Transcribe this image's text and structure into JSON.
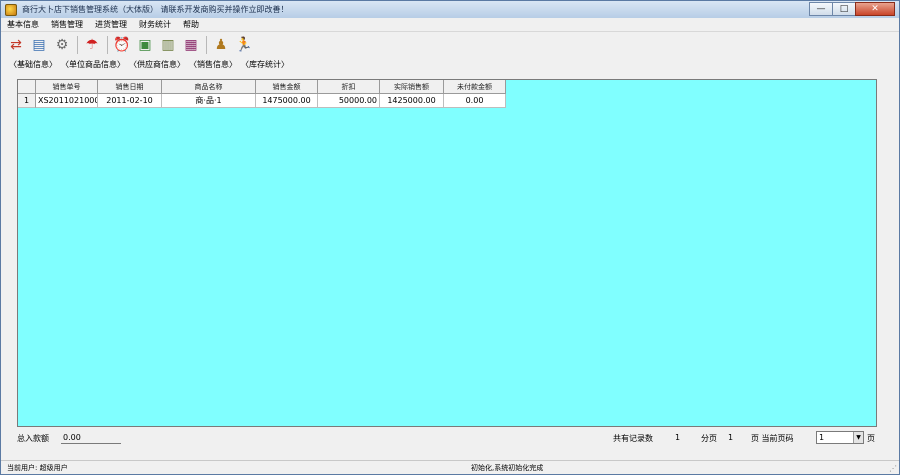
{
  "window": {
    "title": "商行大卜店下销售管理系统（大体版）  请联系开发商购买并操作立即改善！",
    "minimize_label": "—",
    "maximize_label": "□",
    "close_label": "✕"
  },
  "menu": {
    "items": [
      "基本信息",
      "销售管理",
      "进货管理",
      "财务统计",
      "帮助"
    ]
  },
  "toolbar": {
    "icons": [
      {
        "name": "exchange",
        "glyph": "⇄",
        "color": "#c43a2a"
      },
      {
        "name": "folder",
        "glyph": "▤",
        "color": "#3a6fb0"
      },
      {
        "name": "tools",
        "glyph": "⚙",
        "color": "#6a6a6a"
      },
      {
        "name": "umbrella",
        "glyph": "☂",
        "color": "#d02020"
      },
      {
        "name": "alarm-clock",
        "glyph": "⏰",
        "color": "#c01818"
      },
      {
        "name": "picture",
        "glyph": "▣",
        "color": "#3e8a3e"
      },
      {
        "name": "book",
        "glyph": "▥",
        "color": "#6a7a3a"
      },
      {
        "name": "books",
        "glyph": "▦",
        "color": "#8a2a6a"
      },
      {
        "name": "users",
        "glyph": "♟",
        "color": "#b07a20"
      },
      {
        "name": "exit-runner",
        "glyph": "🏃",
        "color": "#d0a010"
      }
    ]
  },
  "tabs": [
    "〈基础信息〉",
    "〈单位商品信息〉",
    "〈供应商信息〉",
    "〈销售信息〉",
    "〈库存统计〉"
  ],
  "table": {
    "columns": [
      "销售单号",
      "销售日期",
      "商品名称",
      "销售金额",
      "折扣",
      "实际销售额",
      "未付款金额"
    ],
    "rows": [
      {
        "num": "1",
        "cells": [
          "XS20110210001",
          "2011-02-10",
          "商·品·1",
          "1475000.00",
          "50000.00",
          "1425000.00",
          "0.00"
        ]
      }
    ]
  },
  "footer": {
    "total_label": "总入款额",
    "total_value": "0.00",
    "records_label": "共有记录数",
    "records_value": "1",
    "pages_label": "分页",
    "pages_value": "1",
    "current_page_label": "页 当前页码",
    "current_page_value": "1",
    "page_suffix": "页"
  },
  "status": {
    "left": "当前用户: 超级用户",
    "middle": "初始化,系统初始化完成"
  }
}
